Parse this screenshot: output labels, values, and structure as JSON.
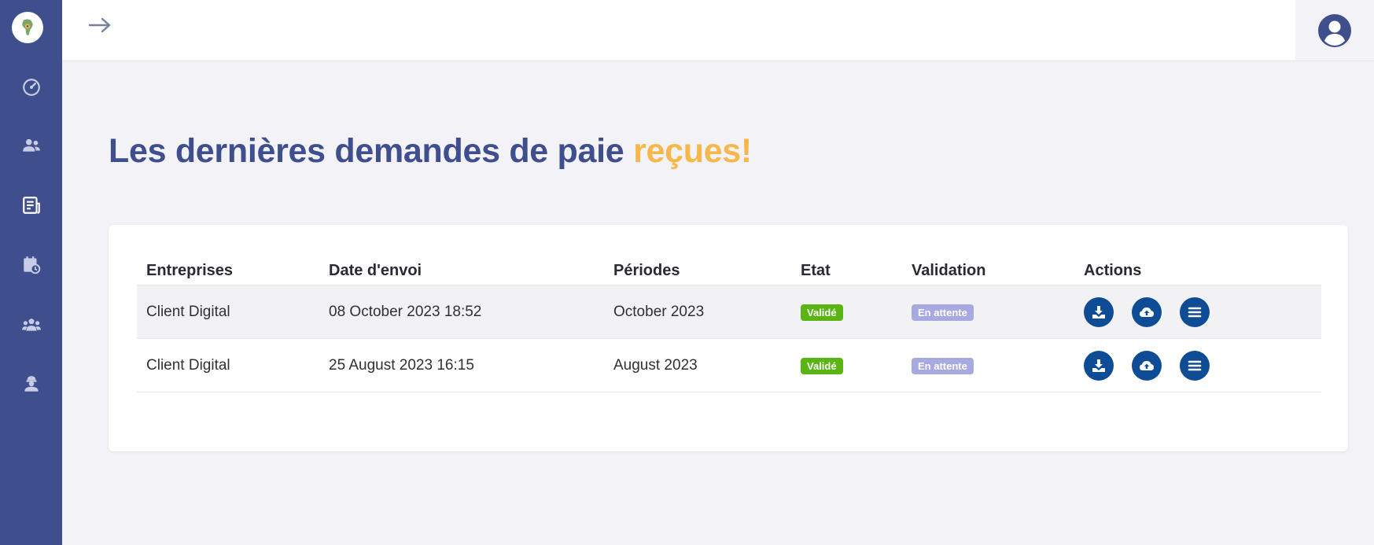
{
  "sidebar": {
    "logo_icon": "africa-map-logo-icon",
    "items": [
      {
        "icon": "speedometer-icon"
      },
      {
        "icon": "users-icon"
      },
      {
        "icon": "document-list-icon"
      },
      {
        "icon": "calendar-clock-icon"
      },
      {
        "icon": "team-icon"
      },
      {
        "icon": "worker-icon"
      }
    ]
  },
  "header": {
    "toggle_icon": "arrow-right-icon",
    "user_icon": "user-circle-icon"
  },
  "main": {
    "title": "Les dernières demandes de paie ",
    "title_accent": "reçues!",
    "title_color": "#3f4e8c",
    "accent_color": "#f7b84b"
  },
  "table": {
    "columns": [
      "Entreprises",
      "Date d'envoi",
      "Périodes",
      "Etat",
      "Validation",
      "Actions"
    ],
    "rows": [
      {
        "entreprise": "Client Digital",
        "date": "08 October 2023 18:52",
        "periode": "October 2023",
        "etat": "Validé",
        "validation": "En attente"
      },
      {
        "entreprise": "Client Digital",
        "date": "25 August 2023 16:15",
        "periode": "August 2023",
        "etat": "Validé",
        "validation": "En attente"
      }
    ],
    "action_icons": [
      "download-icon",
      "cloud-upload-icon",
      "list-menu-icon"
    ]
  },
  "colors": {
    "sidebar": "#3f4e8c",
    "etat_badge": "#5ab413",
    "validation_badge": "#a6aae0",
    "action_button": "#0e4c96"
  }
}
